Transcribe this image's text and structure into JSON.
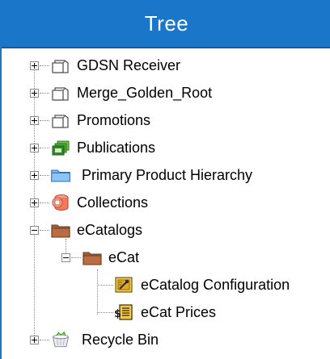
{
  "header": {
    "title": "Tree"
  },
  "tree": {
    "nodes": [
      {
        "label": "GDSN Receiver",
        "expander": "plus",
        "icon": "empty-folder-icon"
      },
      {
        "label": "Merge_Golden_Root",
        "expander": "plus",
        "icon": "empty-folder-icon"
      },
      {
        "label": "Promotions",
        "expander": "plus",
        "icon": "empty-folder-icon"
      },
      {
        "label": "Publications",
        "expander": "plus",
        "icon": "publications-icon"
      },
      {
        "label": "Primary Product Hierarchy",
        "expander": "plus",
        "icon": "blue-folder-icon"
      },
      {
        "label": "Collections",
        "expander": "plus",
        "icon": "collections-icon"
      },
      {
        "label": "eCatalogs",
        "expander": "minus",
        "icon": "brown-folder-icon"
      },
      {
        "label": "eCat",
        "expander": "minus",
        "icon": "brown-folder-icon"
      },
      {
        "label": "eCatalog Configuration",
        "expander": "none",
        "icon": "catalog-configuration-icon"
      },
      {
        "label": "eCat Prices",
        "expander": "none",
        "icon": "prices-icon"
      },
      {
        "label": "Recycle Bin",
        "expander": "plus",
        "icon": "recycle-bin-icon"
      }
    ]
  },
  "colors": {
    "header": "#1a76c8",
    "text": "#000000"
  }
}
